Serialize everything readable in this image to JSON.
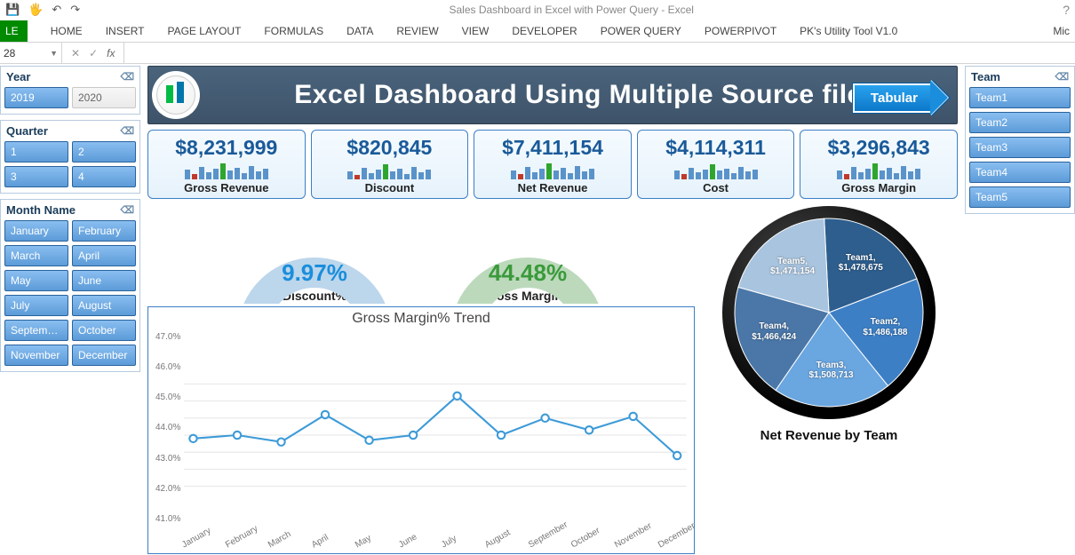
{
  "window_title": "Sales Dashboard in Excel with Power Query - Excel",
  "account_short": "Mic",
  "ribbon_tabs": [
    "FILE",
    "HOME",
    "INSERT",
    "PAGE LAYOUT",
    "FORMULAS",
    "DATA",
    "REVIEW",
    "VIEW",
    "DEVELOPER",
    "POWER QUERY",
    "POWERPIVOT",
    "PK's Utility Tool V1.0"
  ],
  "namebox_value": "28",
  "banner_title": "Excel Dashboard Using Multiple Source file",
  "tabular_button": "Tabular",
  "slicers": {
    "year": {
      "title": "Year",
      "cols": 2,
      "items": [
        {
          "label": "2019",
          "sel": true
        },
        {
          "label": "2020",
          "sel": false,
          "off": true
        }
      ]
    },
    "quarter": {
      "title": "Quarter",
      "cols": 2,
      "items": [
        {
          "label": "1",
          "sel": true
        },
        {
          "label": "2",
          "sel": true
        },
        {
          "label": "3",
          "sel": true
        },
        {
          "label": "4",
          "sel": true
        }
      ]
    },
    "month": {
      "title": "Month Name",
      "cols": 2,
      "items": [
        {
          "label": "January",
          "sel": true
        },
        {
          "label": "February",
          "sel": true
        },
        {
          "label": "March",
          "sel": true
        },
        {
          "label": "April",
          "sel": true
        },
        {
          "label": "May",
          "sel": true
        },
        {
          "label": "June",
          "sel": true
        },
        {
          "label": "July",
          "sel": true
        },
        {
          "label": "August",
          "sel": true
        },
        {
          "label": "Septem…",
          "sel": true
        },
        {
          "label": "October",
          "sel": true
        },
        {
          "label": "November",
          "sel": true
        },
        {
          "label": "December",
          "sel": true
        }
      ]
    },
    "team": {
      "title": "Team",
      "cols": 1,
      "items": [
        {
          "label": "Team1",
          "sel": true
        },
        {
          "label": "Team2",
          "sel": true
        },
        {
          "label": "Team3",
          "sel": true
        },
        {
          "label": "Team4",
          "sel": true
        },
        {
          "label": "Team5",
          "sel": true
        }
      ]
    }
  },
  "kpis": [
    {
      "value": "$8,231,999",
      "label": "Gross Revenue",
      "spark": [
        11,
        6,
        14,
        8,
        12,
        18,
        10,
        13,
        7,
        15,
        9,
        12
      ],
      "hi": 5,
      "lo": 1
    },
    {
      "value": "$820,845",
      "label": "Discount",
      "spark": [
        9,
        5,
        13,
        7,
        11,
        17,
        9,
        12,
        6,
        14,
        8,
        11
      ],
      "hi": 5,
      "lo": 1
    },
    {
      "value": "$7,411,154",
      "label": "Net Revenue",
      "spark": [
        10,
        6,
        14,
        8,
        12,
        18,
        10,
        13,
        7,
        15,
        9,
        12
      ],
      "hi": 5,
      "lo": 1
    },
    {
      "value": "$4,114,311",
      "label": "Cost",
      "spark": [
        10,
        6,
        13,
        8,
        11,
        17,
        10,
        12,
        7,
        14,
        9,
        11
      ],
      "hi": 5,
      "lo": 1
    },
    {
      "value": "$3,296,843",
      "label": "Gross Margin",
      "spark": [
        10,
        6,
        14,
        8,
        12,
        18,
        10,
        13,
        7,
        15,
        9,
        12
      ],
      "hi": 5,
      "lo": 1
    }
  ],
  "donuts": {
    "discount": {
      "pct_text": "9.97%",
      "caption": "Discount%",
      "value": 9.97,
      "color_fill": "#1a8edc",
      "color_track": "#bcd6ec"
    },
    "margin": {
      "pct_text": "44.48%",
      "caption": "Gross Margin%",
      "value": 44.48,
      "color_fill": "#4aa64a",
      "color_track": "#bcd9bc"
    }
  },
  "pie": {
    "caption": "Net Revenue by Team",
    "slices": [
      {
        "name": "Team1",
        "value": 1478675,
        "label": "Team1,\n$1,478,675",
        "color": "#2d5e8e"
      },
      {
        "name": "Team2",
        "value": 1486188,
        "label": "Team2,\n$1,486,188",
        "color": "#3d7fc5"
      },
      {
        "name": "Team3",
        "value": 1508713,
        "label": "Team3,\n$1,508,713",
        "color": "#6aa6e0"
      },
      {
        "name": "Team4",
        "value": 1466424,
        "label": "Team4,\n$1,466,424",
        "color": "#4a77a8"
      },
      {
        "name": "Team5",
        "value": 1471154,
        "label": "Team5,\n$1,471,154",
        "color": "#a9c4df"
      }
    ]
  },
  "chart_data": {
    "type": "line",
    "title": "Gross Margin% Trend",
    "ylabel": "",
    "xlabel": "",
    "ylim": [
      41.0,
      47.0
    ],
    "y_ticks": [
      "47.0%",
      "46.0%",
      "45.0%",
      "44.0%",
      "43.0%",
      "42.0%",
      "41.0%"
    ],
    "categories": [
      "January",
      "February",
      "March",
      "April",
      "May",
      "June",
      "July",
      "August",
      "September",
      "October",
      "November",
      "December"
    ],
    "values": [
      43.8,
      44.0,
      43.6,
      45.2,
      43.7,
      44.0,
      46.3,
      44.0,
      45.0,
      44.3,
      45.1,
      42.8
    ]
  }
}
